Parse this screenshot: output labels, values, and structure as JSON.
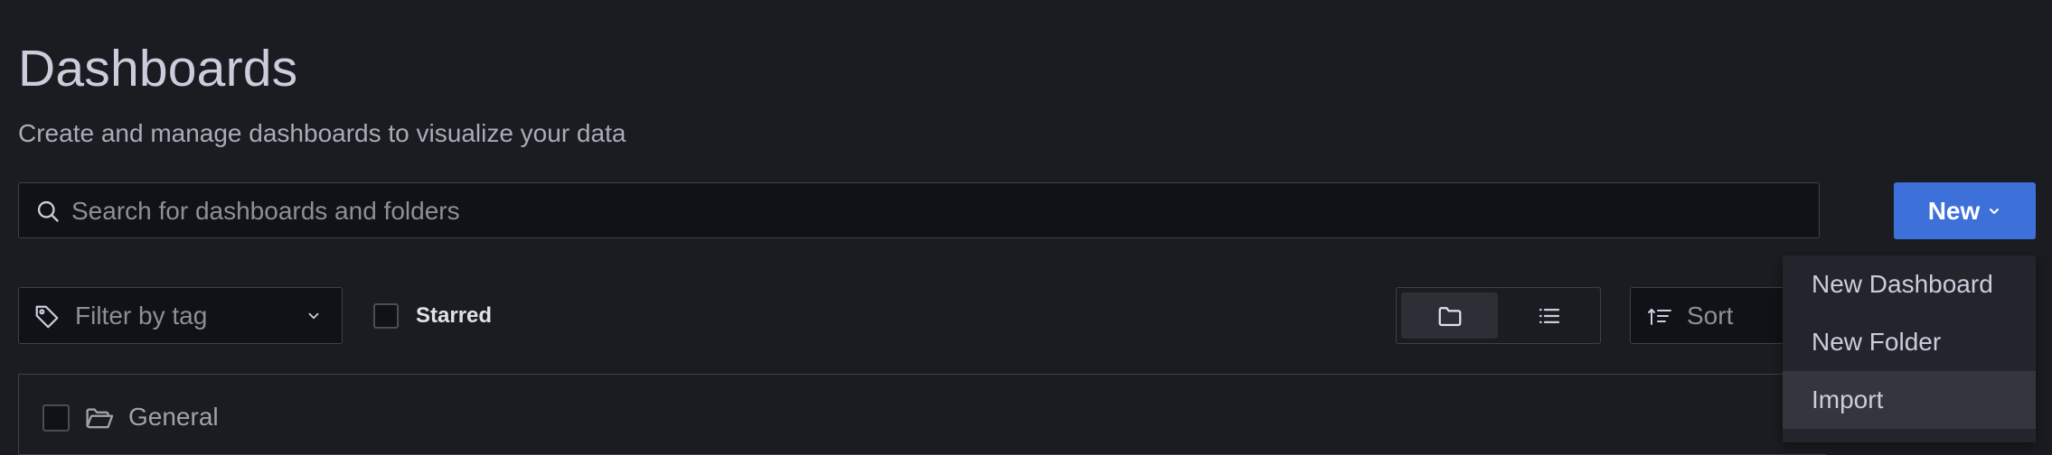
{
  "page": {
    "title": "Dashboards",
    "subtitle": "Create and manage dashboards to visualize your data"
  },
  "search": {
    "placeholder": "Search for dashboards and folders",
    "value": ""
  },
  "new_button": {
    "label": "New",
    "icon": "chevron-down-icon"
  },
  "filters": {
    "tag_placeholder": "Filter by tag",
    "starred_label": "Starred",
    "starred_checked": false,
    "view_modes": [
      "folder-view",
      "list-view"
    ],
    "active_view": "folder-view",
    "sort_label": "Sort"
  },
  "results": [
    {
      "label": "General",
      "icon": "folder-open-icon"
    }
  ],
  "new_menu": {
    "items": [
      {
        "label": "New Dashboard"
      },
      {
        "label": "New Folder"
      },
      {
        "label": "Import",
        "hovered": true
      }
    ]
  },
  "colors": {
    "background": "#1b1c21",
    "primary": "#3d71d9",
    "text": "#ccccdc",
    "muted_text": "#8e8e99",
    "border": "#3f4147",
    "menu_bg": "#22252b",
    "menu_hover": "#34363e"
  }
}
